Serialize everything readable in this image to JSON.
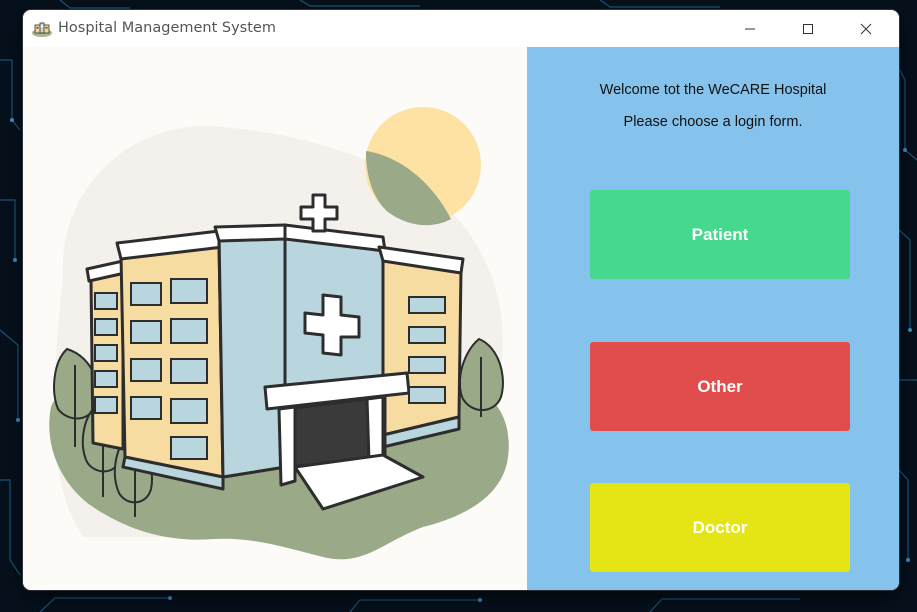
{
  "window": {
    "title": "Hospital Management System"
  },
  "panel": {
    "welcome_line1": "Welcome tot the WeCARE Hospital",
    "welcome_line2": "Please choose a login form.",
    "background": "#85c3ed"
  },
  "buttons": [
    {
      "label": "Patient",
      "color": "#46d88d"
    },
    {
      "label": "Other",
      "color": "#e14c4c"
    },
    {
      "label": "Doctor",
      "color": "#e5e515"
    }
  ],
  "icons": {
    "app": "hospital-app-icon",
    "minimize": "minimize-icon",
    "maximize": "maximize-icon",
    "close": "close-icon"
  }
}
